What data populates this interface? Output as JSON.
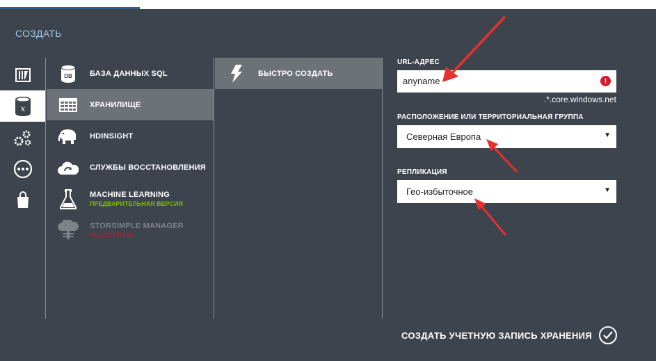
{
  "header": {
    "title": "СОЗДАТЬ"
  },
  "categories": [
    {
      "icon": "compute-icon",
      "selected": false
    },
    {
      "icon": "data-services-icon",
      "selected": true
    },
    {
      "icon": "app-services-icon",
      "selected": false
    },
    {
      "icon": "network-services-icon",
      "selected": false
    },
    {
      "icon": "store-icon",
      "selected": false
    }
  ],
  "services": [
    {
      "label": "БАЗА ДАННЫХ SQL",
      "icon": "database-icon"
    },
    {
      "label": "ХРАНИЛИЩЕ",
      "icon": "storage-table-icon",
      "selected": true
    },
    {
      "label": "HDINSIGHT",
      "icon": "hdinsight-elephant-icon"
    },
    {
      "label": "СЛУЖБЫ ВОССТАНОВЛЕНИЯ",
      "icon": "recovery-cloud-icon"
    },
    {
      "label": "MACHINE LEARNING",
      "sub": "ПРЕДВАРИТЕЛЬНАЯ ВЕРСИЯ",
      "icon": "flask-icon"
    },
    {
      "label": "STORSIMPLE MANAGER",
      "sub": "НЕДОСТУПНО",
      "icon": "storsimple-icon",
      "disabled": true
    }
  ],
  "quick_create": {
    "label": "БЫСТРО СОЗДАТЬ",
    "icon": "lightning-icon"
  },
  "form": {
    "url_label": "URL-АДРЕС",
    "url_value": "anyname",
    "url_suffix": ".*.core.windows.net",
    "location_label": "РАСПОЛОЖЕНИЕ ИЛИ ТЕРРИТОРИАЛЬНАЯ ГРУППА",
    "location_value": "Северная Европа",
    "replication_label": "РЕПЛИКАЦИЯ",
    "replication_value": "Гео-избыточное"
  },
  "submit": {
    "label": "СОЗДАТЬ УЧЕТНУЮ ЗАПИСЬ ХРАНЕНИЯ",
    "icon": "checkmark-icon"
  },
  "colors": {
    "panel": "#3d444e",
    "selected_item": "#6d7178",
    "title": "#9fc8e6",
    "preview_green": "#7fba00",
    "unavailable_red": "#a3243b",
    "error_red": "#d7182a",
    "annotation_arrow": "#e5322d"
  },
  "annotations": [
    {
      "type": "arrow",
      "target": "url-input",
      "icon": "annotation-arrow"
    },
    {
      "type": "arrow",
      "target": "location-select",
      "icon": "annotation-arrow"
    },
    {
      "type": "arrow",
      "target": "replication-select",
      "icon": "annotation-arrow"
    }
  ]
}
